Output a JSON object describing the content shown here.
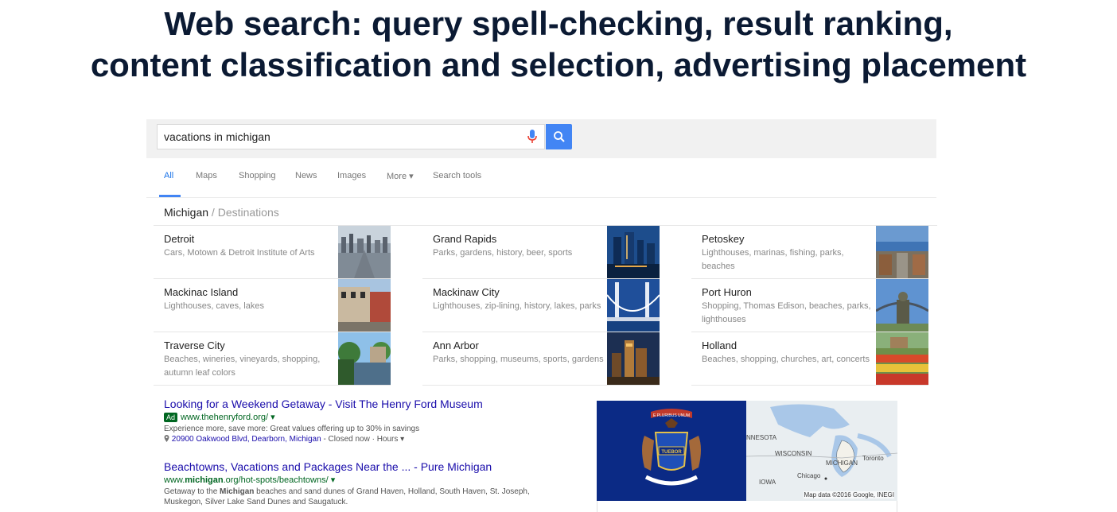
{
  "slide": {
    "title_line1": "Web search: query spell-checking, result ranking,",
    "title_line2": "content classification and selection, advertising placement"
  },
  "search": {
    "query": "vacations in michigan",
    "mic_icon": "microphone-icon",
    "search_icon": "magnifier-icon"
  },
  "tabs": [
    {
      "label": "All",
      "active": true
    },
    {
      "label": "Maps"
    },
    {
      "label": "Shopping"
    },
    {
      "label": "News"
    },
    {
      "label": "Images"
    },
    {
      "label": "More ▾"
    },
    {
      "label": "Search tools"
    }
  ],
  "breadcrumb": {
    "root": "Michigan",
    "separator": "/",
    "child": "Destinations"
  },
  "destinations": [
    {
      "name": "Detroit",
      "desc": "Cars, Motown & Detroit Institute of Arts"
    },
    {
      "name": "Grand Rapids",
      "desc": "Parks, gardens, history, beer, sports"
    },
    {
      "name": "Petoskey",
      "desc": "Lighthouses, marinas, fishing, parks, beaches"
    },
    {
      "name": "Mackinac Island",
      "desc": "Lighthouses, caves, lakes"
    },
    {
      "name": "Mackinaw City",
      "desc": "Lighthouses, zip-lining, history, lakes, parks"
    },
    {
      "name": "Port Huron",
      "desc": "Shopping, Thomas Edison, beaches, parks, lighthouses"
    },
    {
      "name": "Traverse City",
      "desc": "Beaches, wineries, vineyards, shopping, autumn leaf colors"
    },
    {
      "name": "Ann Arbor",
      "desc": "Parks, shopping, museums, sports, gardens"
    },
    {
      "name": "Holland",
      "desc": "Beaches, shopping, churches, art, concerts"
    }
  ],
  "results": [
    {
      "title": "Looking for a Weekend Getaway - Visit The Henry Ford Museum",
      "ad_label": "Ad",
      "url": "www.thehenryford.org/ ▾",
      "desc": "Experience more, save more: Great values offering up to 30% in savings",
      "address_link": "20900 Oakwood Blvd, Dearborn, Michigan",
      "address_rest": " - Closed now · Hours ▾"
    },
    {
      "title": "Beachtowns, Vacations and Packages Near the ... - Pure Michigan",
      "url_pre": "www.",
      "url_bold": "michigan",
      "url_post": ".org/hot-spots/beachtowns/ ▾",
      "desc_a": "Getaway to the ",
      "desc_bold": "Michigan",
      "desc_b": " beaches and sand dunes of Grand Haven, Holland, South Haven, St. Joseph, Muskegon, Silver Lake Sand Dunes and Saugatuck."
    }
  ],
  "knowledge_panel": {
    "flag_motto": "E PLURIBUS UNUM",
    "flag_tuebor": "TUEBOR",
    "map_labels": [
      "NNESOTA",
      "WISCONSIN",
      "MICHIGAN",
      "Toronto",
      "Chicago",
      "IOWA"
    ],
    "map_credit": "Map data ©2016 Google, INEGI"
  },
  "colors": {
    "link": "#1a0dab",
    "url_green": "#006621",
    "accent_blue": "#4285f4",
    "title_navy": "#0b1a33"
  }
}
